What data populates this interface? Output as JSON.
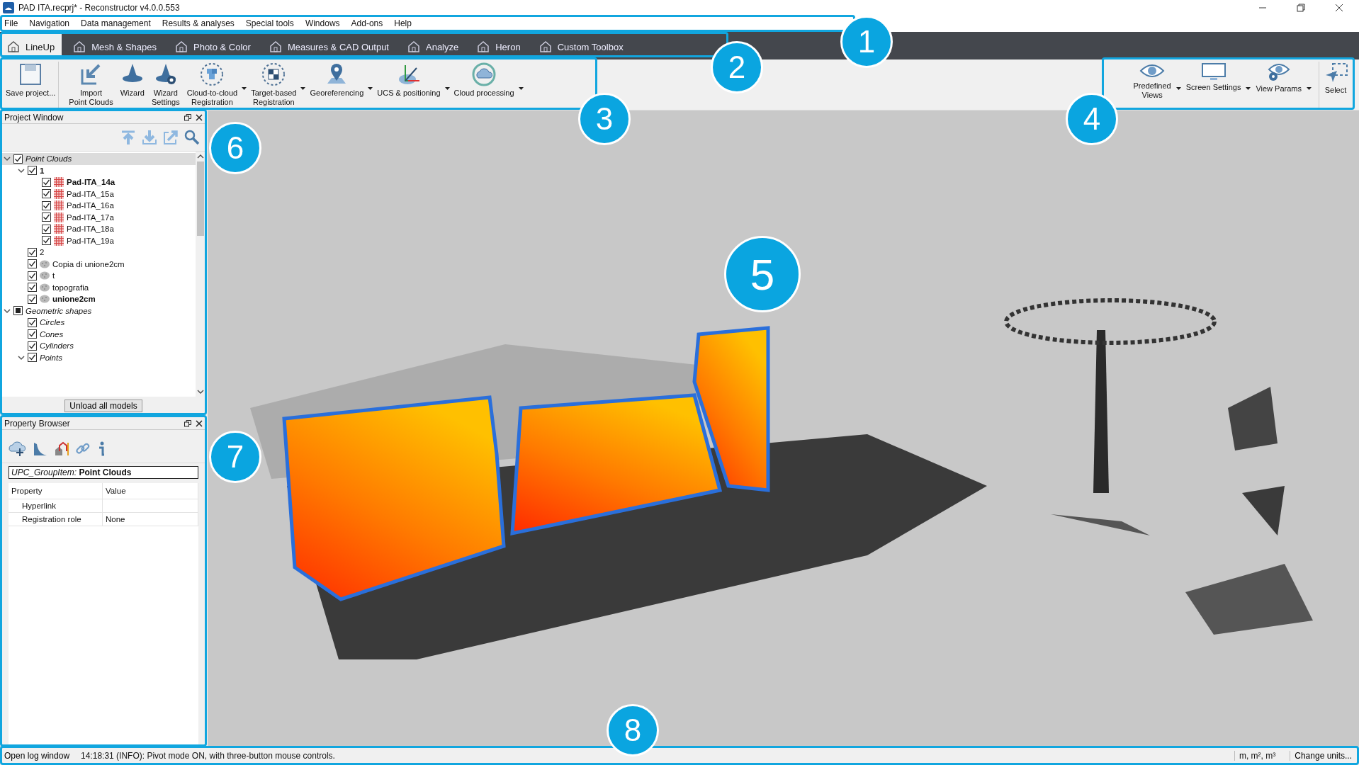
{
  "window": {
    "title": "PAD ITA.recprj* - Reconstructor v4.0.0.553"
  },
  "menu": [
    "File",
    "Navigation",
    "Data management",
    "Results & analyses",
    "Special tools",
    "Windows",
    "Add-ons",
    "Help"
  ],
  "tabs": [
    {
      "label": "LineUp",
      "selected": true
    },
    {
      "label": "Mesh & Shapes",
      "selected": false
    },
    {
      "label": "Photo & Color",
      "selected": false
    },
    {
      "label": "Measures & CAD Output",
      "selected": false
    },
    {
      "label": "Analyze",
      "selected": false
    },
    {
      "label": "Heron",
      "selected": false
    },
    {
      "label": "Custom Toolbox",
      "selected": false
    }
  ],
  "toolbar_left": [
    {
      "label": "Save project...",
      "dropdown": false
    },
    {
      "label": "Import\nPoint Clouds",
      "dropdown": false
    },
    {
      "label": "Wizard",
      "dropdown": false
    },
    {
      "label": "Wizard\nSettings",
      "dropdown": false
    },
    {
      "label": "Cloud-to-cloud\nRegistration",
      "dropdown": true
    },
    {
      "label": "Target-based\nRegistration",
      "dropdown": true
    },
    {
      "label": "Georeferencing",
      "dropdown": true
    },
    {
      "label": "UCS & positioning",
      "dropdown": true
    },
    {
      "label": "Cloud processing",
      "dropdown": true
    }
  ],
  "toolbar_right": [
    {
      "label": "Predefined\nViews",
      "dropdown": true
    },
    {
      "label": "Screen Settings",
      "dropdown": true
    },
    {
      "label": "View Params",
      "dropdown": true
    },
    {
      "label": "Select",
      "dropdown": false
    }
  ],
  "project_window": {
    "title": "Project Window",
    "button": "Unload all models",
    "tree": [
      {
        "label": "Point Clouds",
        "kind": "group",
        "checked": true,
        "partial": false,
        "expanded": true,
        "selected": true,
        "children": [
          {
            "label": "1",
            "kind": "folder",
            "checked": true,
            "partial": false,
            "expanded": true,
            "selected": false,
            "children": [
              {
                "label": "Pad-ITA_14a",
                "kind": "scan",
                "checked": true,
                "partial": false,
                "active": true,
                "selected": false
              },
              {
                "label": "Pad-ITA_15a",
                "kind": "scan",
                "checked": true,
                "partial": false,
                "active": false,
                "selected": false
              },
              {
                "label": "Pad-ITA_16a",
                "kind": "scan",
                "checked": true,
                "partial": false,
                "active": false,
                "selected": false
              },
              {
                "label": "Pad-ITA_17a",
                "kind": "scan",
                "checked": true,
                "partial": false,
                "active": false,
                "selected": false
              },
              {
                "label": "Pad-ITA_18a",
                "kind": "scan",
                "checked": true,
                "partial": false,
                "active": false,
                "selected": false
              },
              {
                "label": "Pad-ITA_19a",
                "kind": "scan",
                "checked": true,
                "partial": false,
                "active": false,
                "selected": false
              }
            ]
          },
          {
            "label": "2",
            "kind": "folder",
            "checked": true,
            "partial": false,
            "selected": false
          },
          {
            "label": "Copia di unione2cm",
            "kind": "cloud",
            "checked": true,
            "partial": false,
            "active": false,
            "selected": false
          },
          {
            "label": "t",
            "kind": "cloud",
            "checked": true,
            "partial": false,
            "active": false,
            "selected": false
          },
          {
            "label": "topografia",
            "kind": "cloud",
            "checked": true,
            "partial": false,
            "active": false,
            "selected": false
          },
          {
            "label": "unione2cm",
            "kind": "cloud",
            "checked": true,
            "partial": false,
            "active": true,
            "selected": false
          }
        ]
      },
      {
        "label": "Geometric shapes",
        "kind": "group",
        "checked": false,
        "partial": true,
        "expanded": true,
        "selected": false,
        "children": [
          {
            "label": "Circles",
            "kind": "group",
            "checked": true,
            "partial": false,
            "selected": false
          },
          {
            "label": "Cones",
            "kind": "group",
            "checked": true,
            "partial": false,
            "selected": false
          },
          {
            "label": "Cylinders",
            "kind": "group",
            "checked": true,
            "partial": false,
            "selected": false
          },
          {
            "label": "Points",
            "kind": "group",
            "checked": true,
            "partial": false,
            "expanded": true,
            "selected": false
          }
        ]
      }
    ]
  },
  "property_browser": {
    "title": "Property Browser",
    "item": "*UPC_GroupItem:* **Point Clouds**",
    "columns": [
      "Property",
      "Value"
    ],
    "rows": [
      {
        "property": "Hyperlink"
      },
      {
        "property": "Registration role",
        "value": "None"
      }
    ]
  },
  "status_bar": {
    "log_button": "Open log window",
    "message": "14:18:31 (INFO): Pivot mode ON, with three-button mouse controls.",
    "units": "m, m², m³",
    "units_button": "Change units..."
  },
  "callouts": [
    "1",
    "2",
    "3",
    "4",
    "5",
    "6",
    "7",
    "8"
  ]
}
